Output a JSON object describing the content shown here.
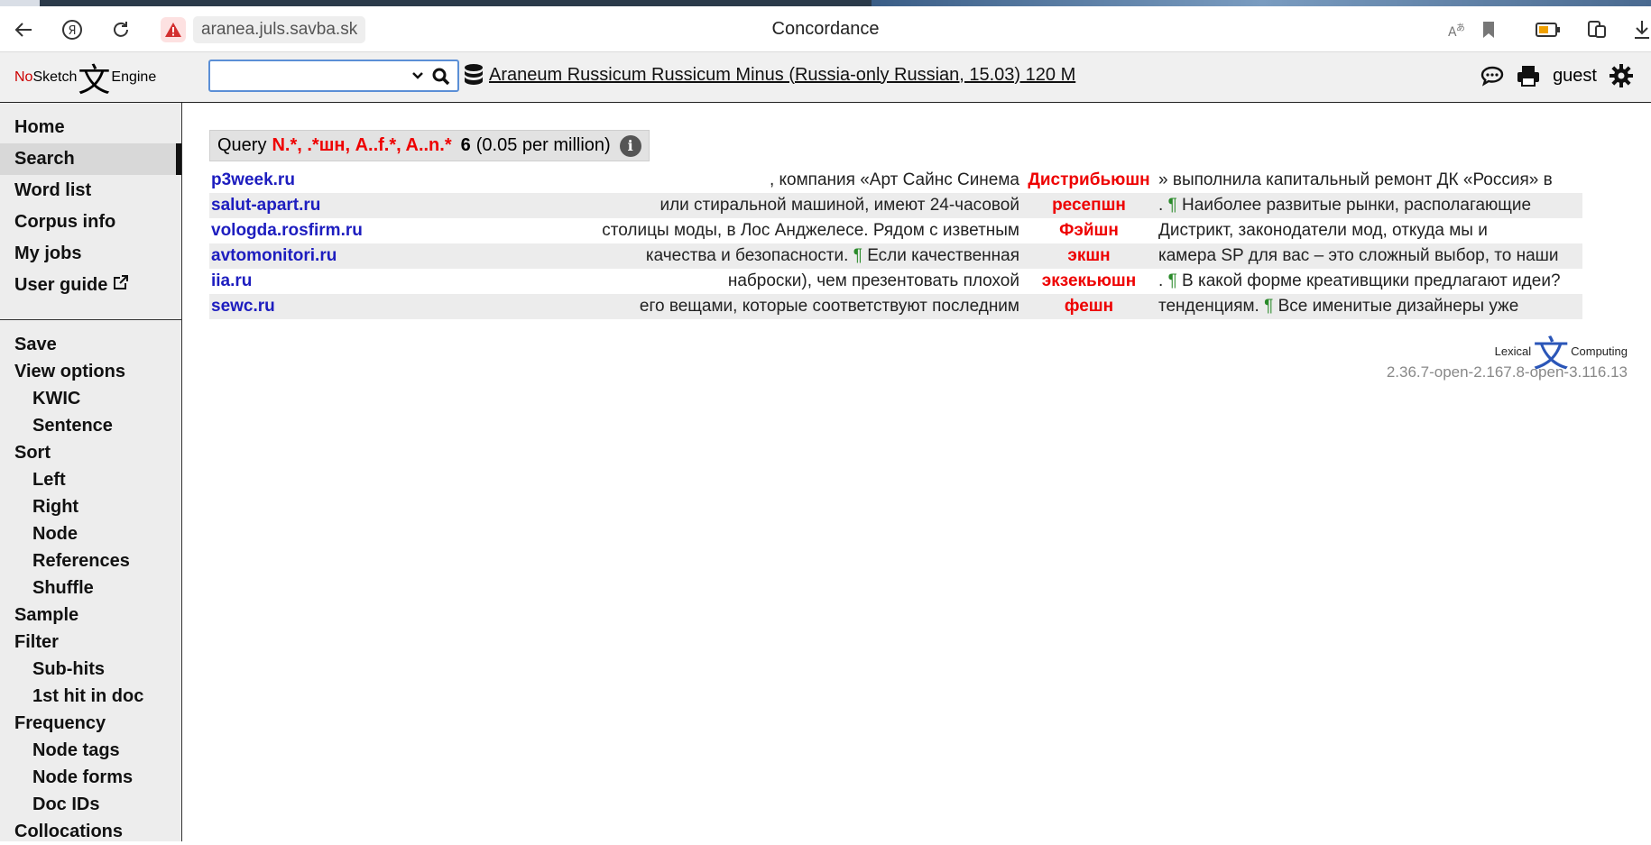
{
  "browser": {
    "url": "aranea.juls.savba.sk",
    "title": "Concordance"
  },
  "header": {
    "logo_no": "No",
    "logo_sketch": "Sketch",
    "logo_glyph": "文",
    "logo_engine": "Engine",
    "search_value": "",
    "corpus_name": "Araneum Russicum Russicum Minus (Russia-only Russian, 15.03) 120 M",
    "user": "guest"
  },
  "sidebar": {
    "top_items": [
      {
        "label": "Home"
      },
      {
        "label": "Search"
      },
      {
        "label": "Word list"
      },
      {
        "label": "Corpus info"
      },
      {
        "label": "My jobs"
      },
      {
        "label": "User guide"
      }
    ],
    "bottom_items": [
      {
        "label": "Save"
      },
      {
        "label": "View options"
      },
      {
        "label": "KWIC"
      },
      {
        "label": "Sentence"
      },
      {
        "label": "Sort"
      },
      {
        "label": "Left"
      },
      {
        "label": "Right"
      },
      {
        "label": "Node"
      },
      {
        "label": "References"
      },
      {
        "label": "Shuffle"
      },
      {
        "label": "Sample"
      },
      {
        "label": "Filter"
      },
      {
        "label": "Sub-hits"
      },
      {
        "label": "1st hit in doc"
      },
      {
        "label": "Frequency"
      },
      {
        "label": "Node tags"
      },
      {
        "label": "Node forms"
      },
      {
        "label": "Doc IDs"
      },
      {
        "label": "Collocations"
      }
    ]
  },
  "query": {
    "label": "Query",
    "expression": "N.*, .*шн, A..f.*, A..n.*",
    "count": "6",
    "per_million": "(0.05 per million)"
  },
  "concordance": [
    {
      "ref": "p3week.ru",
      "left": ", компания «Арт Сайнс Синема",
      "kwic": "Дистрибьюшн",
      "right": "» выполнила капитальный ремонт ДК «Россия» в"
    },
    {
      "ref": "salut-apart.ru",
      "left": "или стиральной машиной, имеют 24-часовой",
      "kwic": "ресепшн",
      "right_pre": ". ",
      "para": "¶",
      "right": " Наиболее развитые рынки, располагающие"
    },
    {
      "ref": "vologda.rosfirm.ru",
      "left": "столицы моды, в Лос Анджелесе. Рядом с изветным",
      "kwic": "Фэйшн",
      "right": "Дистрикт, законодатели мод, откуда мы и"
    },
    {
      "ref": "avtomonitori.ru",
      "left_pre": "качества и безопасности. ",
      "para": "¶",
      "left": " Если качественная",
      "kwic": "экшн",
      "right": "камера SP для вас – это сложный выбор, то наши"
    },
    {
      "ref": "iia.ru",
      "left": "наброски), чем презентовать плохой",
      "kwic": "экзекьюшн",
      "right_pre": ". ",
      "para": "¶",
      "right": " В какой форме креативщики предлагают идеи?"
    },
    {
      "ref": "sewc.ru",
      "left": "его вещами, которые соответствуют последним",
      "kwic": "фешн",
      "right_pre": "тенденциям. ",
      "para": "¶",
      "right": " Все именитые дизайнеры уже"
    }
  ],
  "footer": {
    "lc_left": "Lexical",
    "lc_glyph": "文",
    "lc_right": "Computing",
    "version": "2.36.7-open-2.167.8-open-3.116.13"
  }
}
